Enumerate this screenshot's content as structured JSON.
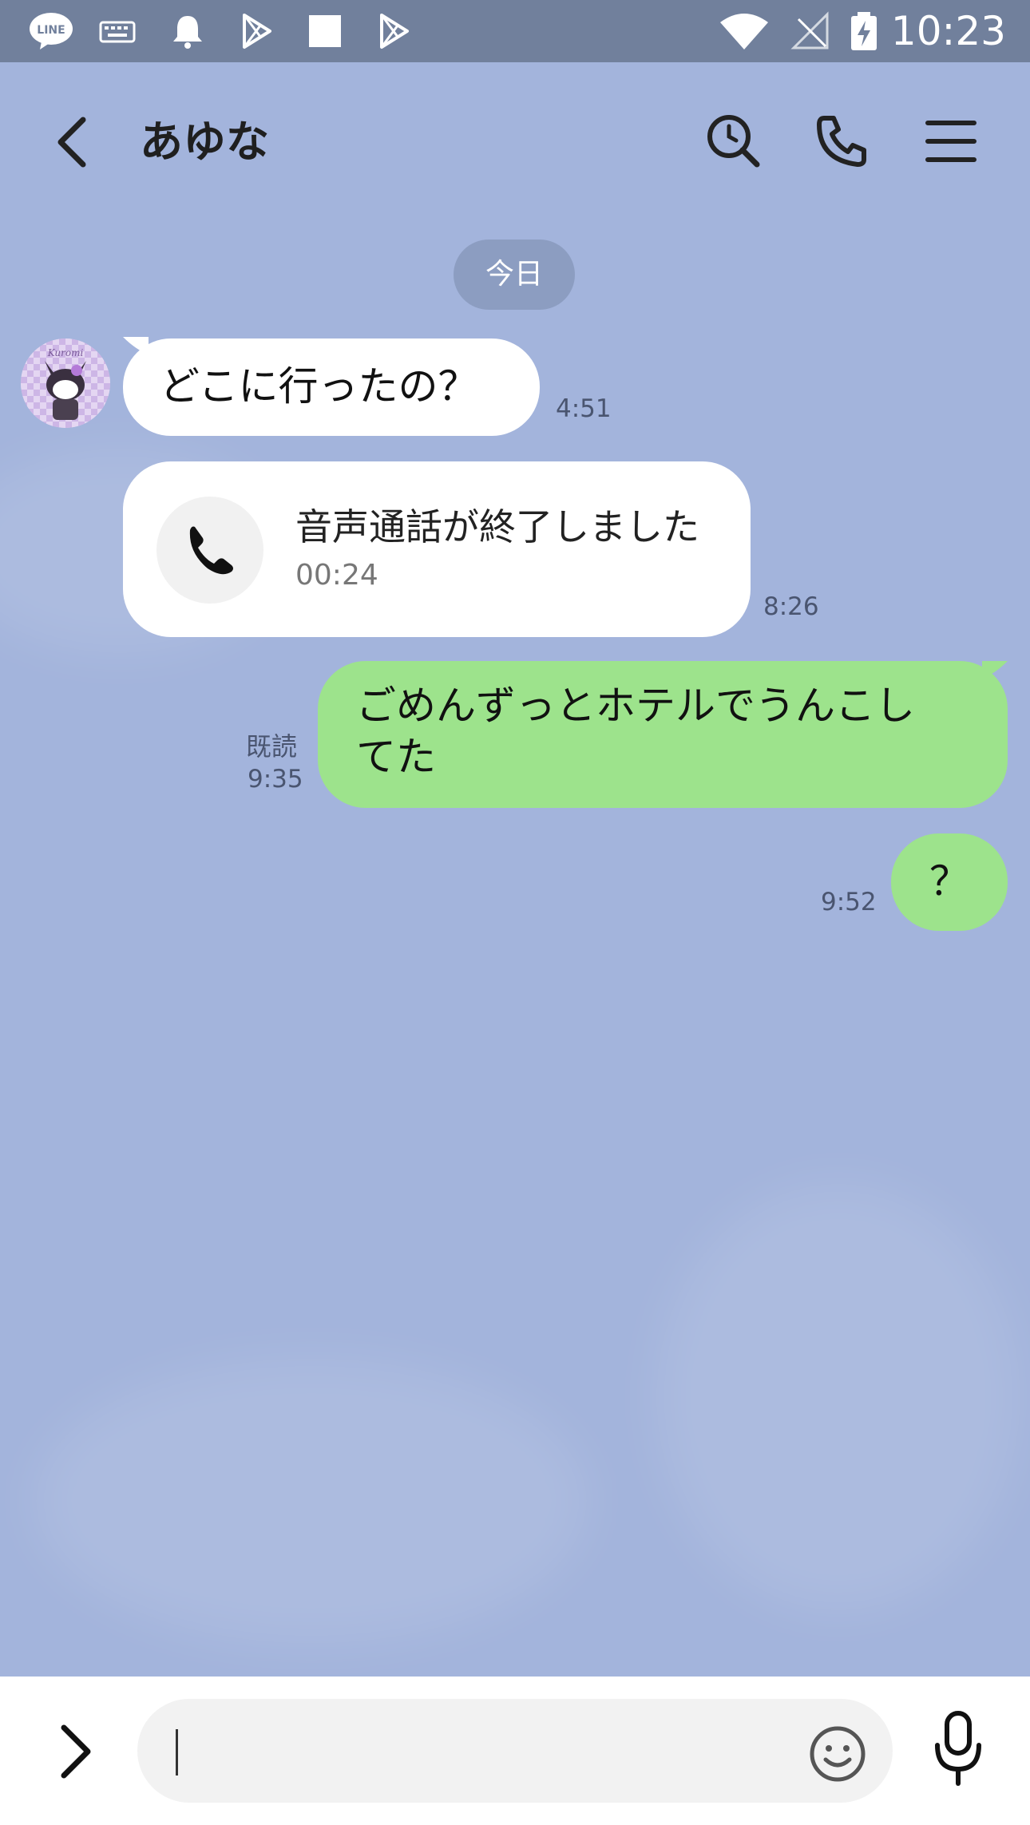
{
  "status_bar": {
    "time": "10:23",
    "icons": [
      "line-app-icon",
      "keyboard-icon",
      "notification-bell-icon",
      "play-store-icon",
      "square-icon",
      "play-store-icon",
      "wifi-icon",
      "no-signal-icon",
      "battery-charging-icon"
    ]
  },
  "header": {
    "title": "あゆな",
    "icons": [
      "back-chevron-icon",
      "search-icon",
      "phone-icon",
      "menu-icon"
    ]
  },
  "date_separator": "今日",
  "messages": [
    {
      "side": "received",
      "text": "どこに行ったの？",
      "time": "4:51"
    },
    {
      "side": "received",
      "type": "call",
      "call_title": "音声通話が終了しました",
      "call_duration": "00:24",
      "time": "8:26"
    },
    {
      "side": "sent",
      "text": "ごめんずっとホテルでうんこし てた",
      "line1": "ごめんずっとホテルでうんこし",
      "line2": "てた",
      "read_label": "既読",
      "time": "9:35"
    },
    {
      "side": "sent",
      "text": "？",
      "time": "9:52"
    }
  ],
  "input": {
    "value": "",
    "icons": [
      "expand-chevron-icon",
      "emoji-icon",
      "microphone-icon"
    ]
  },
  "colors": {
    "background": "#a3b4dc",
    "status_bar": "#71809c",
    "sent_bubble": "#9de38c",
    "received_bubble": "#ffffff",
    "date_pill": "#8c9dc1"
  }
}
